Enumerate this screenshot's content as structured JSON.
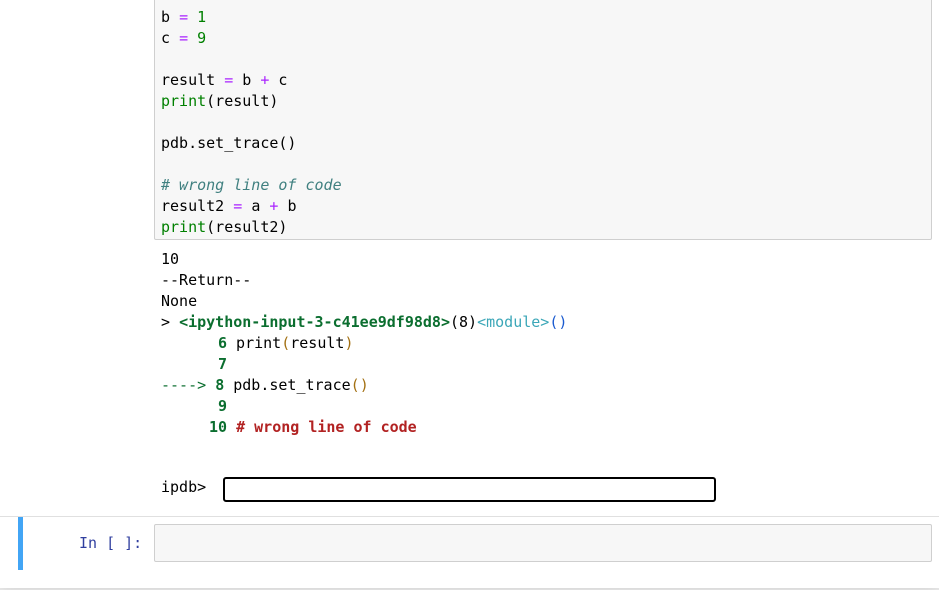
{
  "code_cell": {
    "lines": [
      {
        "var": "b",
        "op": "=",
        "num": "1"
      },
      {
        "var": "c",
        "op": "=",
        "num": "9"
      },
      {
        "lhs": "result",
        "op": "=",
        "a": "b",
        "plus": "+",
        "b": "c"
      },
      {
        "fn": "print",
        "args": "(result)"
      },
      {
        "text": "pdb.set_trace()"
      },
      {
        "comment": "# wrong line of code"
      },
      {
        "lhs": "result2",
        "op": "=",
        "a": "a",
        "plus": "+",
        "b": "b"
      },
      {
        "fn": "print",
        "args": "(result2)"
      }
    ]
  },
  "output": {
    "line1": "10",
    "line2": "--Return--",
    "line3": "None",
    "trace_prefix": "> ",
    "trace_file": "<ipython-input-3-c41ee9df98d8>",
    "trace_lineno": "(8)",
    "trace_module": "<module>",
    "trace_parens": "()",
    "src": [
      {
        "no": "6",
        "pre": " print",
        "p1": "(",
        "mid": "result",
        "p2": ")"
      },
      {
        "no": "7"
      },
      {
        "arrow": "---->",
        "no": "8",
        "pre": " pdb.set_trace",
        "p1": "(",
        "p2": ")"
      },
      {
        "no": "9"
      },
      {
        "no": "10",
        "comment": " # wrong line of code"
      }
    ]
  },
  "ipdb": {
    "label": "ipdb>",
    "value": ""
  },
  "next_cell": {
    "prompt": "In [ ]:"
  },
  "colors": {
    "accent": "#42a5f5",
    "prompt": "#303f9f",
    "keyword_op": "#aa22ff",
    "number": "#008000",
    "comment": "#408080"
  }
}
